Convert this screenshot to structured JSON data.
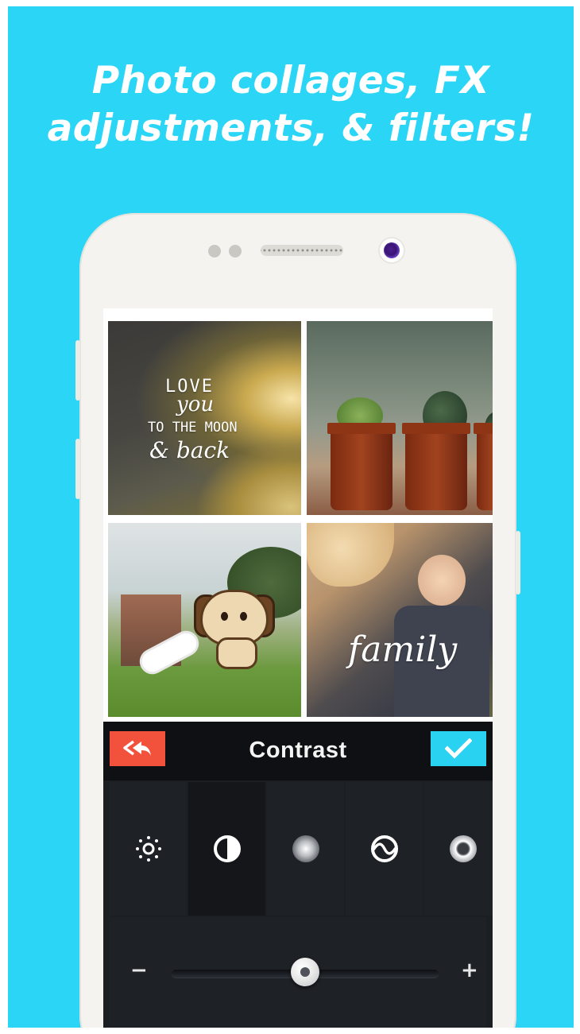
{
  "promo": {
    "headline_line1": "Photo collages, FX",
    "headline_line2": "adjustments, & filters!"
  },
  "collage": {
    "tiles": [
      {
        "overlay_text_line1": "LOVE",
        "overlay_text_line2": "you",
        "overlay_text_line3": "TO THE MOON",
        "overlay_text_line4": "& back"
      },
      {
        "overlay_text_line1": ""
      },
      {
        "overlay_text_line1": ""
      },
      {
        "overlay_text_line1": "family"
      }
    ]
  },
  "toolbar": {
    "title": "Contrast",
    "back_icon": "double-back-arrow-icon",
    "confirm_icon": "checkmark-icon",
    "back_color": "#f2523b",
    "confirm_color": "#2ad2f2"
  },
  "tools": [
    {
      "icon": "brightness-icon",
      "active": false
    },
    {
      "icon": "contrast-icon",
      "active": true
    },
    {
      "icon": "vignette-icon",
      "active": false
    },
    {
      "icon": "saturation-wave-icon",
      "active": false
    },
    {
      "icon": "blur-ring-icon",
      "active": false
    }
  ],
  "slider": {
    "minus_label": "−",
    "plus_label": "+",
    "value_fraction": 0.5
  },
  "colors": {
    "background": "#2ad5f6",
    "phone_body": "#f4f3ef",
    "panel": "#1e2126"
  }
}
